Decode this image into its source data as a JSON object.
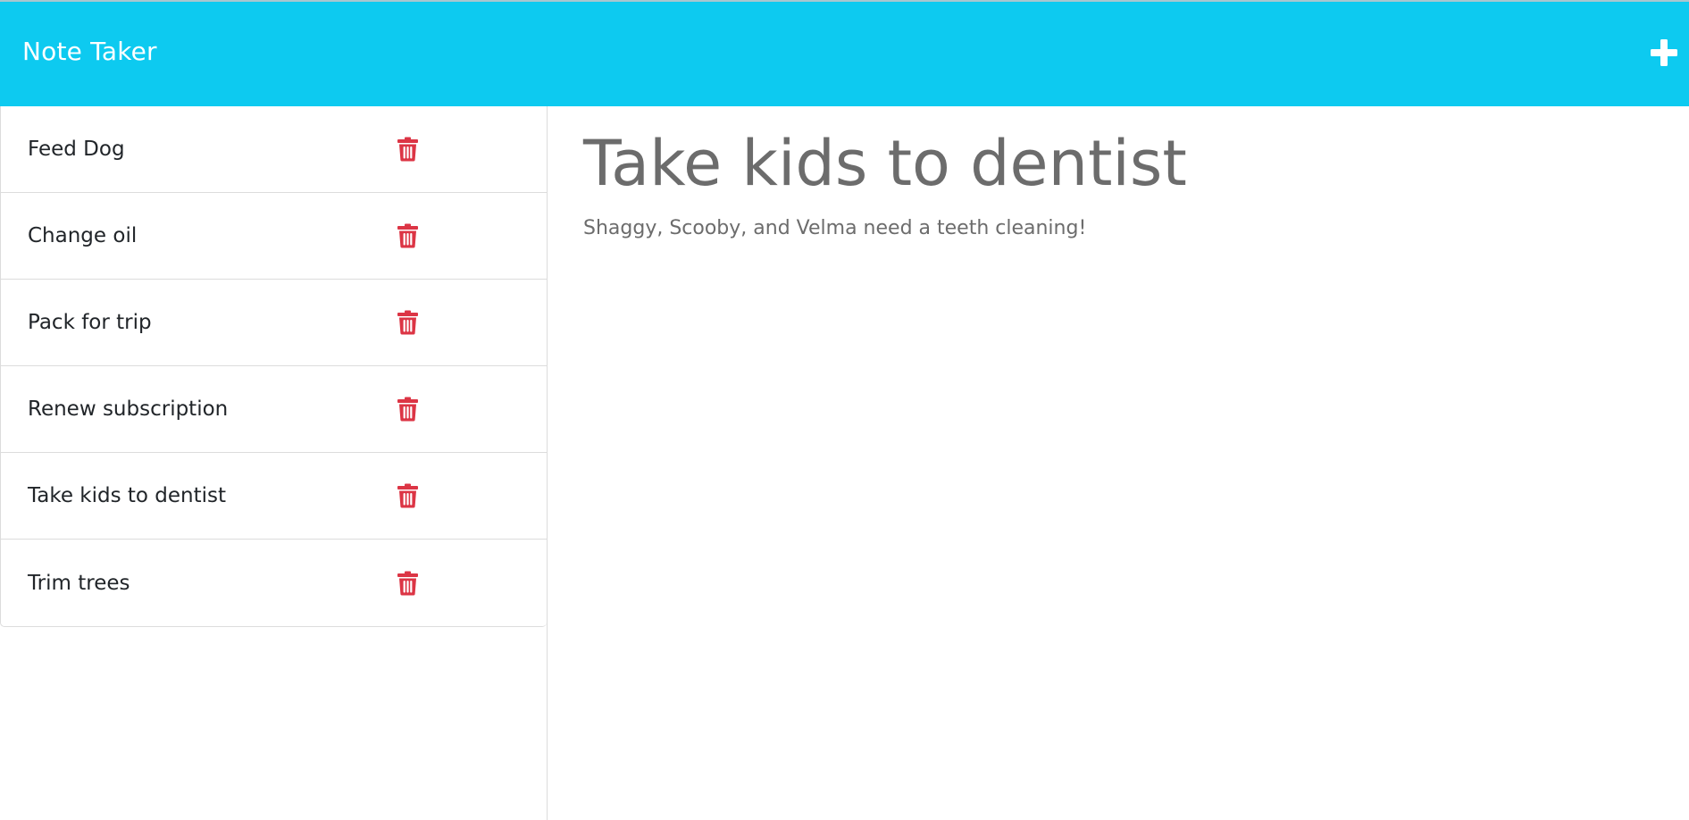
{
  "app": {
    "brand": "Note Taker"
  },
  "colors": {
    "navbar": "#0dcaf0",
    "delete": "#dc3545",
    "text": "#212529",
    "muted": "#6c6c6c"
  },
  "icons": {
    "add": "plus-icon",
    "delete": "trash-icon"
  },
  "notes": [
    {
      "title": "Feed Dog"
    },
    {
      "title": "Change oil"
    },
    {
      "title": "Pack for trip"
    },
    {
      "title": "Renew subscription"
    },
    {
      "title": "Take kids to dentist"
    },
    {
      "title": "Trim trees"
    }
  ],
  "active_note": {
    "title": "Take kids to dentist",
    "text": "Shaggy, Scooby, and Velma need a teeth cleaning!"
  }
}
